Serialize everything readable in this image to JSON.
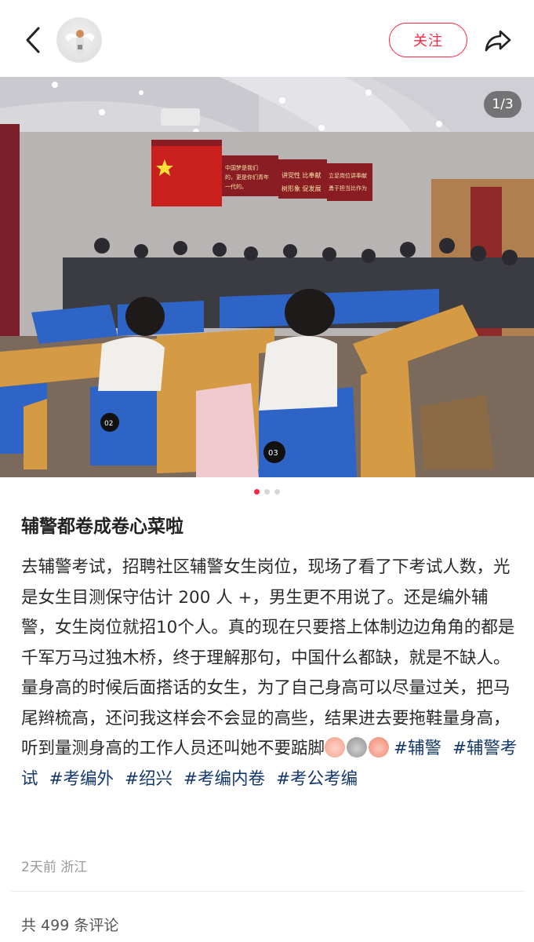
{
  "header": {
    "back_icon": "chevron-left-icon",
    "follow_label": "关注",
    "share_icon": "share-arrow-icon",
    "accent": "#ff2442"
  },
  "gallery": {
    "page_indicator": "1/3",
    "total": 3,
    "current": 1,
    "photo_signs": {
      "left_banner": "中国梦是我们的，更是你们青年一代的。",
      "center_banner": "讲党性 比奉献 树形象 促发展",
      "right_banner": "立足岗位讲奉献 勇于担当比作为",
      "seat_1": "02",
      "seat_2": "03"
    }
  },
  "post": {
    "title": "辅警都卷成卷心菜啦",
    "body": "去辅警考试，招聘社区辅警女生岗位，现场了看了下考试人数，光是女生目测保守估计 200 人 +，男生更不用说了。还是编外辅警，女生岗位就招10个人。真的现在只要搭上体制边边角角的都是千军万马过独木桥，终于理解那句，中国什么都缺，就是不缺人。量身高的时候后面搭话的女生，为了自己身高可以尽量过关，把马尾辫梳高，还问我这样会不会显的高些，结果进去要拖鞋量身高，听到量测身高的工作人员还叫她不要踮脚",
    "tags": [
      "#辅警",
      "#辅警考试",
      "#考编外",
      "#绍兴",
      "#考编内卷",
      "#考公考编"
    ],
    "tag_color": "#13386c",
    "meta": "2天前 浙江",
    "comment_count_text": "共 499 条评论"
  }
}
